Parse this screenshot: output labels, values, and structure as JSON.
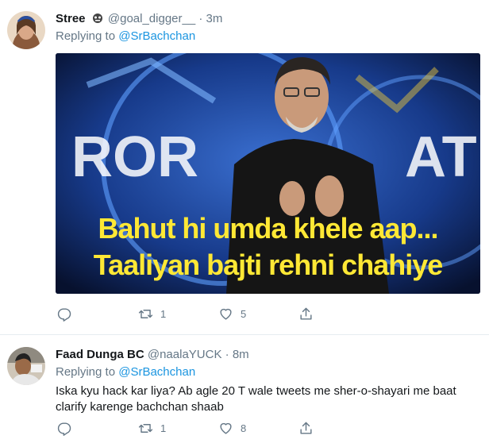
{
  "tweets": [
    {
      "display_name": "Stree",
      "handle": "@goal_digger__",
      "separator": "·",
      "time": "3m",
      "replying_prefix": "Replying to",
      "replying_to": "@SrBachchan",
      "media": {
        "caption_line1": "Bahut hi umda khele aap...",
        "caption_line2": "Taaliyan bajti rehni chahiye",
        "backdrop_text": "ROR ATI"
      },
      "retweet_count": "1",
      "like_count": "5"
    },
    {
      "display_name": "Faad Dunga BC",
      "handle": "@naalaYUCK",
      "separator": "·",
      "time": "8m",
      "replying_prefix": "Replying to",
      "replying_to": "@SrBachchan",
      "text": "Iska kyu hack kar liya? Ab agle 20 T wale tweets me sher-o-shayari me baat clarify karenge bachchan shaab",
      "retweet_count": "1",
      "like_count": "8"
    }
  ],
  "colors": {
    "text": "#14171a",
    "secondary": "#657786",
    "link": "#1b95e0",
    "caption_yellow": "#ffe835",
    "divider": "#e6ecf0"
  },
  "icons": [
    "reply-icon",
    "retweet-icon",
    "like-icon",
    "share-icon",
    "emoji-badge-icon"
  ]
}
